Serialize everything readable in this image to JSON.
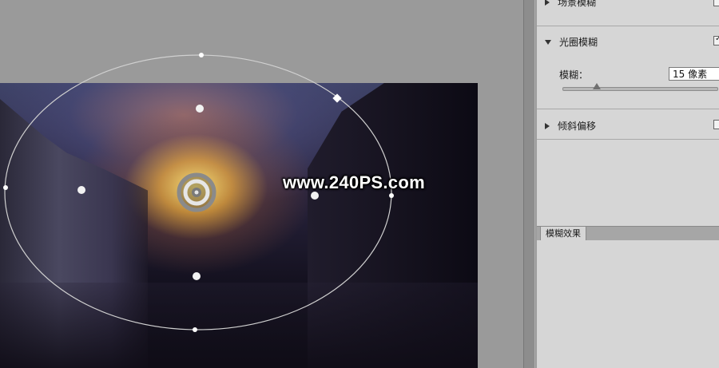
{
  "watermark": "www.240PS.com",
  "panel": {
    "field_blur": {
      "label": "场景模糊",
      "checked": false
    },
    "iris_blur": {
      "label": "光圈模糊",
      "checked": true,
      "blur_label": "模糊：",
      "blur_value": "15 像素",
      "blur_slider_fraction": 0.22
    },
    "tilt_shift": {
      "label": "倾斜偏移",
      "checked": false
    },
    "effects_tab": "模糊效果"
  },
  "colors": {
    "panel_bg": "#d6d6d6",
    "workspace_bg": "#9a9a9a",
    "ring_stroke": "#d0d0d0"
  },
  "icons": [
    "pin-center-icon",
    "handle-point-icon",
    "handle-square-icon",
    "expand-triangle-icon",
    "checkbox-icon"
  ]
}
